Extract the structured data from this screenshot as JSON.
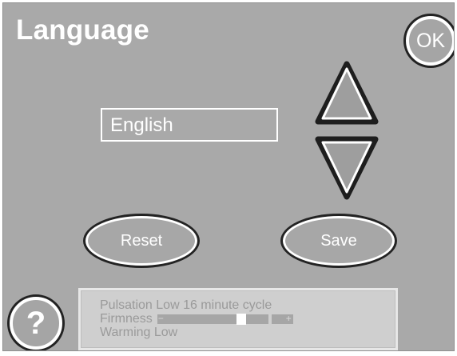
{
  "header": {
    "title": "Language"
  },
  "buttons": {
    "ok_label": "OK",
    "reset_label": "Reset",
    "save_label": "Save",
    "help_label": "?"
  },
  "language": {
    "selected": "English"
  },
  "status": {
    "pulsation": "Pulsation Low  16 minute cycle",
    "firmness_label": "Firmness",
    "firmness_level": 0.62,
    "firmness_minus": "−",
    "firmness_plus": "+",
    "warming": "Warming Low"
  },
  "icons": {
    "up": "triangle-up-icon",
    "down": "triangle-down-icon"
  },
  "colors": {
    "background": "#a9a9a9",
    "text": "#ffffff",
    "panel": "#cfcfcf"
  }
}
